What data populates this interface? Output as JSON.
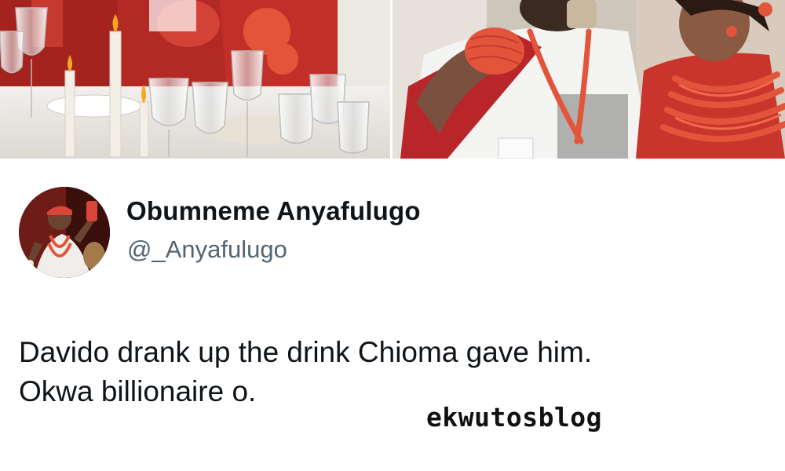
{
  "photos": [
    {
      "name": "left-photo"
    },
    {
      "name": "right-photo"
    }
  ],
  "tweet": {
    "author": {
      "display_name": "Obumneme Anyafulugo",
      "handle": "@_Anyafulugo"
    },
    "text_lines": [
      "Davido drank up the drink Chioma gave him.",
      "Okwa billionaire o."
    ]
  },
  "watermark": "ekwutosblog",
  "colors": {
    "coral_beads": "#e2553b",
    "red_fabric": "#b8262a",
    "text_primary": "#0f1419",
    "text_secondary": "#536471"
  }
}
